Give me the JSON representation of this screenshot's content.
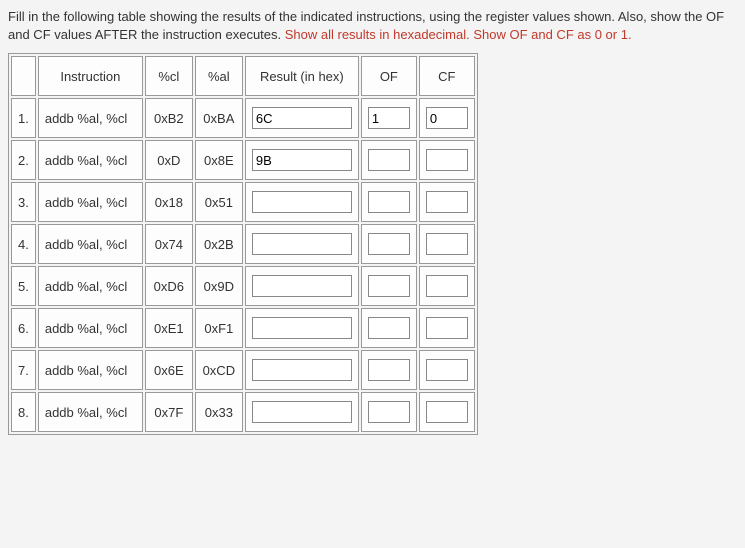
{
  "instructions": {
    "part1": "Fill in the following table showing the results of the indicated instructions, using the register values shown. Also, show the OF and CF values AFTER the instruction executes. ",
    "part2_highlight": "Show all results in hexadecimal. Show OF and CF as 0 or 1."
  },
  "headers": {
    "num": "",
    "instruction": "Instruction",
    "cl": "%cl",
    "al": "%al",
    "result": "Result (in hex)",
    "of": "OF",
    "cf": "CF"
  },
  "rows": [
    {
      "num": "1.",
      "instr": "addb %al, %cl",
      "cl": "0xB2",
      "al": "0xBA",
      "result": "6C",
      "of": "1",
      "cf": "0"
    },
    {
      "num": "2.",
      "instr": "addb %al, %cl",
      "cl": "0xD",
      "al": "0x8E",
      "result": "9B",
      "of": "",
      "cf": ""
    },
    {
      "num": "3.",
      "instr": "addb %al, %cl",
      "cl": "0x18",
      "al": "0x51",
      "result": "",
      "of": "",
      "cf": ""
    },
    {
      "num": "4.",
      "instr": "addb %al, %cl",
      "cl": "0x74",
      "al": "0x2B",
      "result": "",
      "of": "",
      "cf": ""
    },
    {
      "num": "5.",
      "instr": "addb %al, %cl",
      "cl": "0xD6",
      "al": "0x9D",
      "result": "",
      "of": "",
      "cf": ""
    },
    {
      "num": "6.",
      "instr": "addb %al, %cl",
      "cl": "0xE1",
      "al": "0xF1",
      "result": "",
      "of": "",
      "cf": ""
    },
    {
      "num": "7.",
      "instr": "addb %al, %cl",
      "cl": "0x6E",
      "al": "0xCD",
      "result": "",
      "of": "",
      "cf": ""
    },
    {
      "num": "8.",
      "instr": "addb %al, %cl",
      "cl": "0x7F",
      "al": "0x33",
      "result": "",
      "of": "",
      "cf": ""
    }
  ]
}
